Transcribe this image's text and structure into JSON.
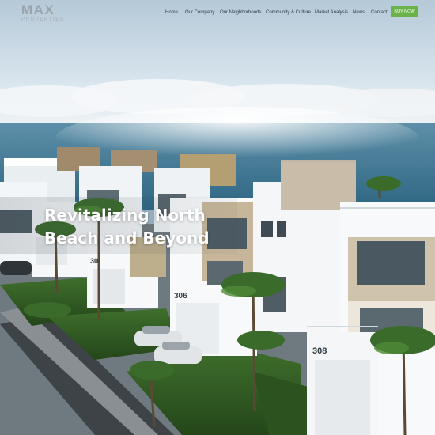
{
  "brand": {
    "name": "MAX",
    "tagline": "PROPERTIES"
  },
  "nav": {
    "items": [
      {
        "label": "Home"
      },
      {
        "label": "Our Company"
      },
      {
        "label": "Our Neighborhoods"
      },
      {
        "label": "Community & Culture"
      },
      {
        "label": "Market Analysis"
      },
      {
        "label": "News"
      },
      {
        "label": "Contact"
      }
    ],
    "cta_label": "BUY NOW"
  },
  "hero": {
    "title_line1": "Revitalizing North",
    "title_line2": "Beach and Beyond",
    "unit_numbers": [
      "308",
      "306",
      "30"
    ]
  },
  "colors": {
    "accent": "#6cb24a",
    "nav_text": "#2d3a46",
    "logo": "#9aa4ad"
  }
}
